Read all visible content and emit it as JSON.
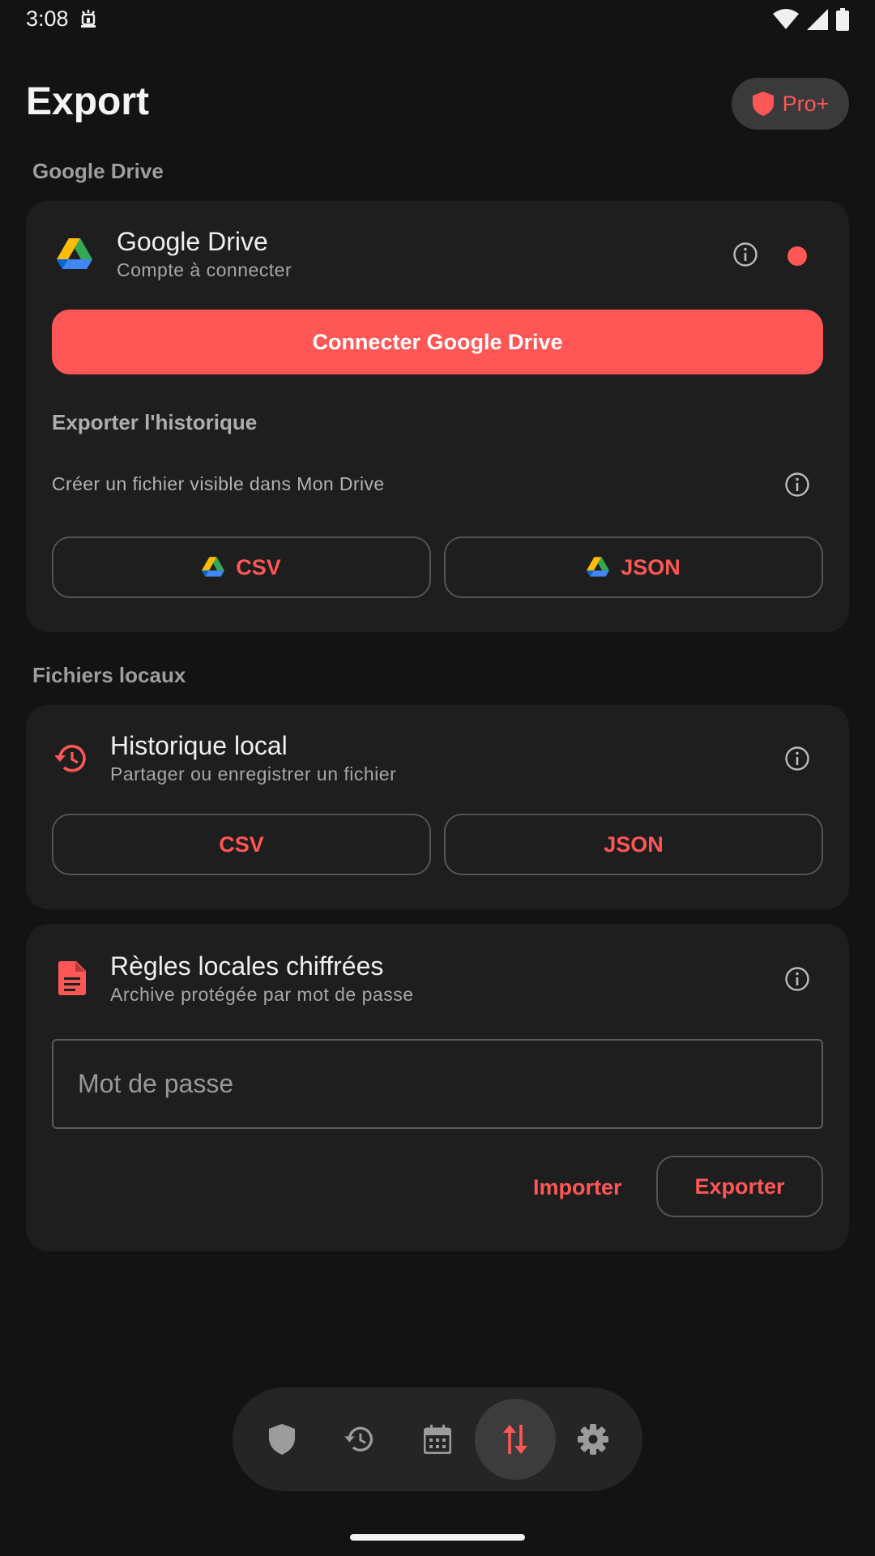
{
  "status_bar": {
    "time": "3:08"
  },
  "header": {
    "title": "Export",
    "pro_label": "Pro+"
  },
  "google_drive_section": {
    "label": "Google Drive",
    "card": {
      "title": "Google Drive",
      "subtitle": "Compte à connecter",
      "status_color": "#ff5656",
      "connect_button": "Connecter Google Drive",
      "export_history_title": "Exporter l'historique",
      "export_hint": "Créer un fichier visible dans Mon Drive",
      "csv_button": "CSV",
      "json_button": "JSON"
    }
  },
  "local_files_section": {
    "label": "Fichiers locaux",
    "history_card": {
      "title": "Historique local",
      "subtitle": "Partager ou enregistrer un fichier",
      "csv_button": "CSV",
      "json_button": "JSON"
    },
    "rules_card": {
      "title": "Règles locales chiffrées",
      "subtitle": "Archive protégée par mot de passe",
      "password_placeholder": "Mot de passe",
      "import_button": "Importer",
      "export_button": "Exporter"
    }
  },
  "bottom_nav": {
    "items": [
      "shield-icon",
      "history-icon",
      "calendar-icon",
      "swap-vertical-icon",
      "gear-icon"
    ],
    "active_index": 3
  },
  "colors": {
    "accent": "#ff5656",
    "background": "#131313",
    "card": "#1e1e1e"
  }
}
